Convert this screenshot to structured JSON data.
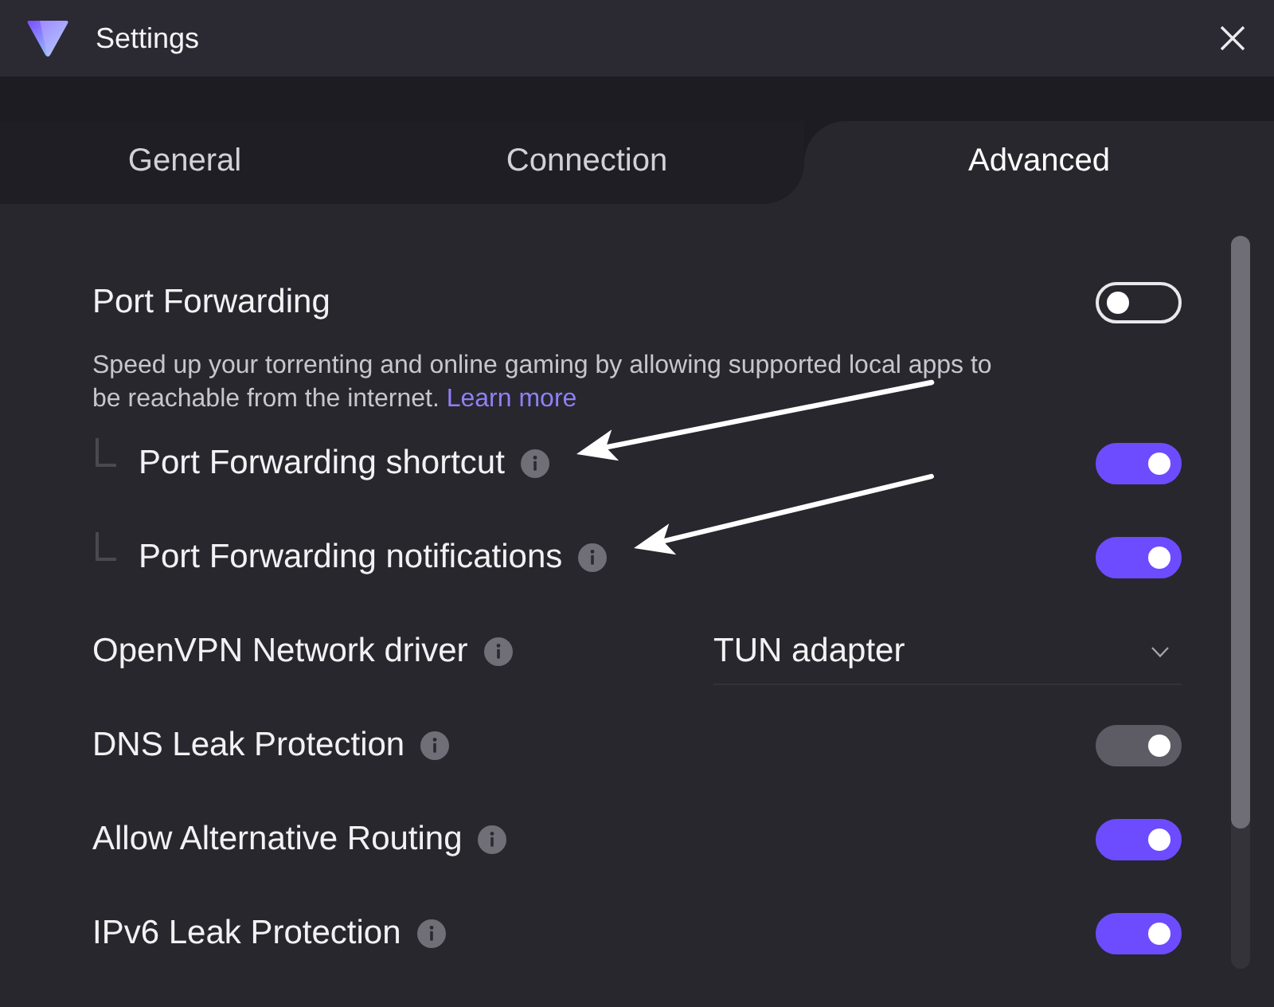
{
  "window": {
    "title": "Settings"
  },
  "tabs": [
    {
      "label": "General",
      "selected": false
    },
    {
      "label": "Connection",
      "selected": false
    },
    {
      "label": "Advanced",
      "selected": true
    }
  ],
  "settings": [
    {
      "kind": "toggle",
      "label": "Port Forwarding",
      "on": false,
      "disabled": false,
      "description": "Speed up your torrenting and online gaming by allowing supported local apps to be reachable from the internet.",
      "link": "Learn more",
      "children": [
        {
          "kind": "toggle",
          "label": "Port Forwarding shortcut",
          "info_icon": true,
          "on": true,
          "disabled": false,
          "annotation_arrow": true
        },
        {
          "kind": "toggle",
          "label": "Port Forwarding notifications",
          "info_icon": true,
          "on": true,
          "disabled": false,
          "annotation_arrow": true
        }
      ]
    },
    {
      "kind": "dropdown",
      "label": "OpenVPN Network driver",
      "info_icon": true,
      "value": "TUN adapter"
    },
    {
      "kind": "toggle",
      "label": "DNS Leak Protection",
      "info_icon": true,
      "on": true,
      "disabled": true
    },
    {
      "kind": "toggle",
      "label": "Allow Alternative Routing",
      "info_icon": true,
      "on": true,
      "disabled": false
    },
    {
      "kind": "toggle",
      "label": "IPv6 Leak Protection",
      "info_icon": true,
      "on": true,
      "disabled": false
    }
  ]
}
